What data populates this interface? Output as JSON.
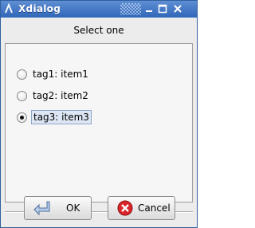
{
  "window": {
    "title": "Xdialog",
    "controls": [
      "minimize-icon",
      "maximize-icon",
      "close-icon"
    ]
  },
  "dialog": {
    "prompt": "Select one",
    "options": [
      {
        "label": "tag1: item1",
        "selected": false
      },
      {
        "label": "tag2: item2",
        "selected": false
      },
      {
        "label": "tag3: item3",
        "selected": true
      }
    ]
  },
  "buttons": {
    "ok": {
      "label": "OK",
      "icon": "enter-arrow-icon"
    },
    "cancel": {
      "label": "Cancel",
      "icon": "cancel-x-icon"
    }
  },
  "colors": {
    "titlebar": "#2f66b9",
    "cancel_icon": "#d9262b"
  }
}
